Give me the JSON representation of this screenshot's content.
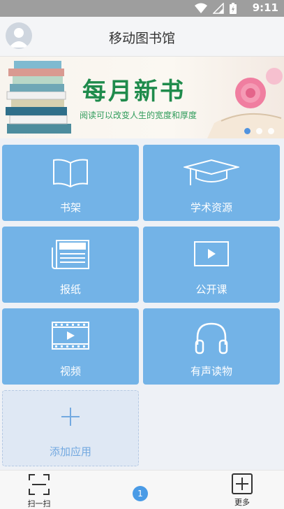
{
  "status_bar": {
    "time": "9:11"
  },
  "header": {
    "title": "移动图书馆"
  },
  "banner": {
    "headline": "每月新书",
    "subtitle": "阅读可以改变人生的宽度和厚度",
    "slide_count": 3,
    "active_slide": 1
  },
  "tiles": [
    {
      "label": "书架",
      "icon": "open-book-icon"
    },
    {
      "label": "学术资源",
      "icon": "graduation-cap-icon"
    },
    {
      "label": "报纸",
      "icon": "newspaper-icon"
    },
    {
      "label": "公开课",
      "icon": "play-screen-icon"
    },
    {
      "label": "视频",
      "icon": "film-strip-icon"
    },
    {
      "label": "有声读物",
      "icon": "headphones-icon"
    }
  ],
  "add_tile": {
    "label": "添加应用",
    "icon": "plus-icon"
  },
  "bottom_bar": {
    "scan_label": "扫一扫",
    "page_badge": "1",
    "more_label": "更多"
  },
  "colors": {
    "tile": "#73b3e7",
    "status_bar": "#9e9e9e",
    "accent": "#4a9be6"
  }
}
